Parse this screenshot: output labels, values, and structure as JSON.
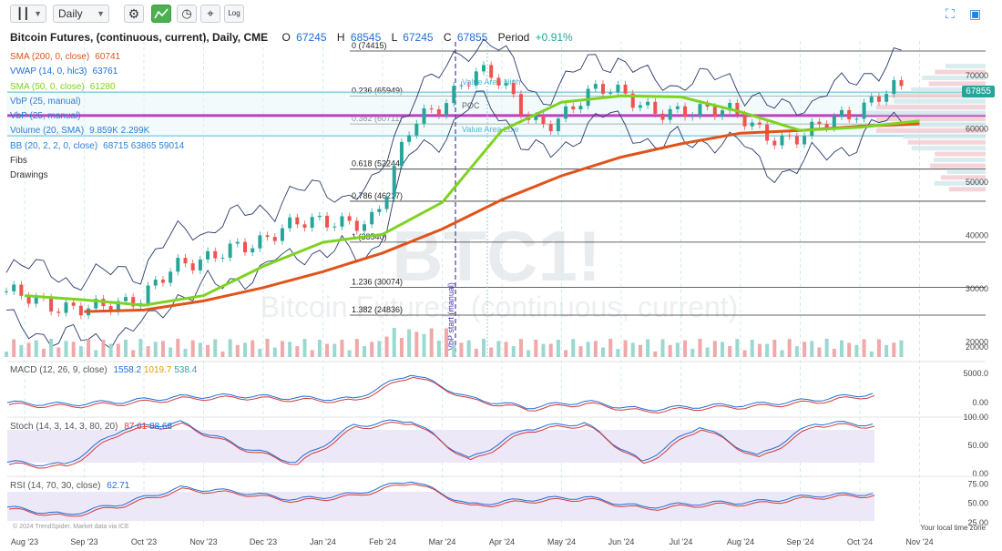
{
  "toolbar": {
    "chart_type_icon": "candles-icon",
    "interval": "Daily",
    "settings_icon": "gear-icon",
    "indicator_icon": "indicators-icon",
    "clock_icon": "clock-icon",
    "crosshair_icon": "crosshair-icon",
    "log_label": "Log",
    "fullscreen_icon": "fullscreen-icon",
    "camera_icon": "camera-icon"
  },
  "header": {
    "title": "Bitcoin Futures, (continuous, current), Daily, CME",
    "o_label": "O",
    "o_value": "67245",
    "h_label": "H",
    "h_value": "68545",
    "l_label": "L",
    "l_value": "67245",
    "c_label": "C",
    "c_value": "67855",
    "period_label": "Period",
    "period_value": "+0.91%"
  },
  "legend": [
    {
      "label": "SMA (200, 0, close)",
      "value": "60741",
      "color": "#e0531b"
    },
    {
      "label": "VWAP (14, 0, hlc3)",
      "value": "63761",
      "color": "#1e6ed6"
    },
    {
      "label": "SMA (50, 0, close)",
      "value": "61280",
      "color": "#7ed321"
    },
    {
      "label": "VbP (25, manual)",
      "value": "",
      "color": "#2c7fd6"
    },
    {
      "label": "VbP (25, manual)",
      "value": "",
      "color": "#2c7fd6"
    },
    {
      "label": "Volume (20, SMA)",
      "value": "9.859K  2.299K",
      "color": "#2c7fd6"
    },
    {
      "label": "BB (20, 2, 2, 0, close)",
      "value": "68715  63865  59014",
      "color": "#2c7fd6"
    },
    {
      "label": "Fibs",
      "value": "",
      "color": "#333333"
    },
    {
      "label": "Drawings",
      "value": "",
      "color": "#333333"
    }
  ],
  "watermark": {
    "symbol": "BTC1!",
    "name": "Bitcoin Futures, (continuous, current)"
  },
  "vbp_label": "VbP start (manual)",
  "value_area": {
    "high": "Value Area High",
    "low": "Value Area Low",
    "poc": "POC"
  },
  "fibs": [
    {
      "label": "0 (74415)",
      "price": 74415
    },
    {
      "label": "0.236 (65949)",
      "price": 65949
    },
    {
      "label": "0.382 (60711)",
      "price": 60711
    },
    {
      "label": "0.618 (52244)",
      "price": 52244
    },
    {
      "label": "0.786 (46217)",
      "price": 46217
    },
    {
      "label": "1 (38540)",
      "price": 38540
    },
    {
      "label": "1.236 (30074)",
      "price": 30074
    },
    {
      "label": "1.382 (24836)",
      "price": 24836
    }
  ],
  "last_price": "67855",
  "indicators": {
    "macd": {
      "label": "MACD (12, 26, 9, close)",
      "v1": "1558.2",
      "v2": "1019.7",
      "v3": "538.4"
    },
    "stoch": {
      "label": "Stoch (14, 3, 14, 3, 80, 20)",
      "v1": "87.61",
      "v2": "88.68"
    },
    "rsi": {
      "label": "RSI (14, 70, 30, close)",
      "v1": "62.71"
    }
  },
  "colors": {
    "up": "#26a69a",
    "down": "#ef5350",
    "sma200": "#e0531b",
    "sma50": "#7ed321",
    "bb": "#2c7fd6",
    "purple": "#c23fc2",
    "grid": "#d4ecec"
  },
  "footer": {
    "copyright": "© 2024 TrendSpider. Market data via ICE",
    "local_time": "Your local time zone"
  },
  "chart_data": [
    {
      "type": "candlestick",
      "x": [
        "Aug '23",
        "Sep '23",
        "Oct '23",
        "Nov '23",
        "Dec '23",
        "Jan '24",
        "Feb '24",
        "Mar '24",
        "Apr '24",
        "May '24",
        "Jun '24",
        "Jul '24",
        "Aug '24",
        "Sep '24",
        "Oct '24",
        "Nov '24"
      ],
      "y_ticks": [
        20000,
        30000,
        40000,
        50000,
        60000,
        70000
      ],
      "ylim": [
        18000,
        75000
      ],
      "series": [
        {
          "name": "Close",
          "values": [
            29300,
            26000,
            27000,
            34500,
            37800,
            42500,
            42000,
            62500,
            70500,
            60500,
            67500,
            62800,
            63500,
            57500,
            62000,
            67855
          ]
        },
        {
          "name": "SMA (200, 0, close)",
          "values": [
            null,
            25500,
            25800,
            27500,
            30000,
            33000,
            36500,
            41000,
            46500,
            51000,
            54500,
            57000,
            59000,
            59500,
            60300,
            60741
          ]
        },
        {
          "name": "SMA (50, 0, close)",
          "values": [
            28500,
            27700,
            26700,
            28500,
            34000,
            38500,
            40000,
            46000,
            59500,
            64800,
            66000,
            65800,
            63000,
            59500,
            60100,
            61280
          ]
        }
      ]
    },
    {
      "type": "bar",
      "name": "Volume (20, SMA)",
      "ylim": [
        0,
        20000
      ]
    },
    {
      "type": "line",
      "name": "MACD (12, 26, 9, close)",
      "y_ticks": [
        0.0,
        5000.0
      ],
      "series": [
        {
          "name": "MACD",
          "values": [
            0,
            -300,
            200,
            1000,
            1200,
            800,
            600,
            5000,
            800,
            -800,
            200,
            -1200,
            -600,
            -300,
            500,
            1558.2
          ]
        }
      ]
    },
    {
      "type": "line",
      "name": "Stoch (14, 3, 14, 3, 80, 20)",
      "y_ticks": [
        0.0,
        50.0,
        100.0
      ],
      "ylim": [
        0,
        100
      ],
      "series": [
        {
          "name": "%K",
          "values": [
            20,
            15,
            80,
            90,
            50,
            20,
            85,
            95,
            25,
            80,
            90,
            20,
            85,
            30,
            90,
            87.61
          ]
        }
      ]
    },
    {
      "type": "line",
      "name": "RSI (14, 70, 30, close)",
      "y_ticks": [
        25.0,
        50.0,
        75.0
      ],
      "ylim": [
        20,
        85
      ],
      "series": [
        {
          "name": "RSI",
          "values": [
            45,
            35,
            50,
            70,
            65,
            55,
            62,
            80,
            48,
            55,
            58,
            45,
            50,
            52,
            60,
            62.71
          ]
        }
      ]
    }
  ]
}
